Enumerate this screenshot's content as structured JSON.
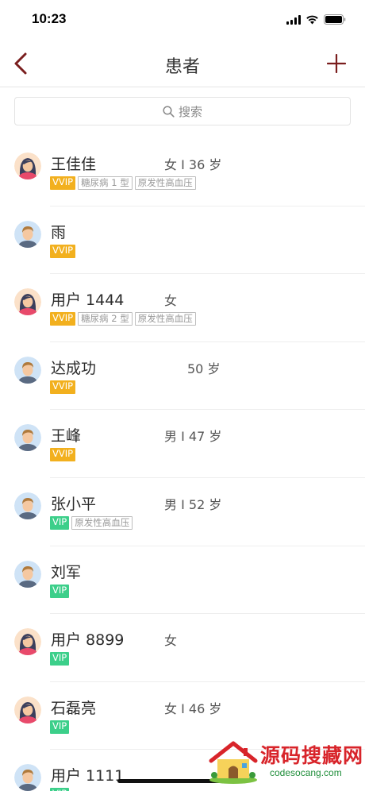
{
  "status_bar": {
    "time": "10:23"
  },
  "nav": {
    "title": "患者",
    "back_icon": "chevron-left-icon",
    "add_icon": "plus-icon",
    "accent": "#7a1e1e"
  },
  "search": {
    "placeholder": "搜索"
  },
  "patients": [
    {
      "name": "王佳佳",
      "info": "女 I 36 岁",
      "gender": "female",
      "tags": [
        {
          "text": "VVIP",
          "type": "vvip"
        },
        {
          "text": "糖尿病 1 型",
          "type": "disease"
        },
        {
          "text": "原发性高血压",
          "type": "disease"
        }
      ]
    },
    {
      "name": "雨",
      "info": "",
      "gender": "male",
      "tags": [
        {
          "text": "VVIP",
          "type": "vvip"
        }
      ]
    },
    {
      "name": "用户 1444",
      "info": "女",
      "gender": "female",
      "tags": [
        {
          "text": "VVIP",
          "type": "vvip"
        },
        {
          "text": "糖尿病 2 型",
          "type": "disease"
        },
        {
          "text": "原发性高血压",
          "type": "disease"
        }
      ]
    },
    {
      "name": "达成功",
      "info": "50 岁",
      "gender": "male",
      "tags": [
        {
          "text": "VVIP",
          "type": "vvip"
        }
      ]
    },
    {
      "name": "王峰",
      "info": "男 I 47 岁",
      "gender": "male",
      "tags": [
        {
          "text": "VVIP",
          "type": "vvip"
        }
      ]
    },
    {
      "name": "张小平",
      "info": "男 I 52 岁",
      "gender": "male",
      "tags": [
        {
          "text": "VIP",
          "type": "vip"
        },
        {
          "text": "原发性高血压",
          "type": "disease"
        }
      ]
    },
    {
      "name": "刘军",
      "info": "",
      "gender": "male",
      "tags": [
        {
          "text": "VIP",
          "type": "vip"
        }
      ]
    },
    {
      "name": "用户 8899",
      "info": "女",
      "gender": "female",
      "tags": [
        {
          "text": "VIP",
          "type": "vip"
        }
      ]
    },
    {
      "name": "石磊亮",
      "info": "女 I 46 岁",
      "gender": "female",
      "tags": [
        {
          "text": "VIP",
          "type": "vip"
        }
      ]
    },
    {
      "name": "用户 1111",
      "info": "",
      "gender": "male",
      "tags": [
        {
          "text": "VIP",
          "type": "vip"
        }
      ]
    }
  ],
  "watermark": {
    "title": "源码搜藏网",
    "url": "codesocang.com"
  },
  "colors": {
    "vvip": "#f2b01e",
    "vip": "#3ccf8a",
    "disease_border": "#bdbdbd"
  }
}
